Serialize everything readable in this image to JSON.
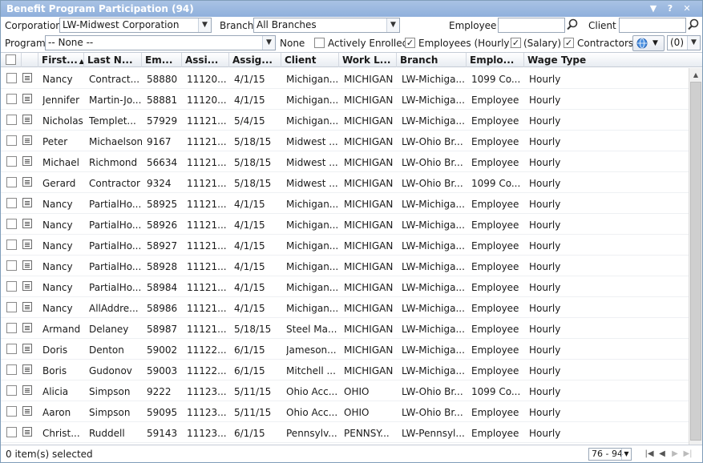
{
  "window": {
    "title": "Benefit Program Participation (94)",
    "controls": {
      "menu": "▼",
      "help": "?",
      "close": "✕"
    }
  },
  "filters": {
    "corporation_label": "Corporation",
    "corporation_value": "LW-Midwest Corporation",
    "branch_label": "Branch",
    "branch_value": "All Branches",
    "employee_label": "Employee",
    "employee_value": "",
    "client_label": "Client",
    "client_value": "",
    "program_label": "Program",
    "program_value": "-- None --",
    "none_label": "None",
    "actively_enrolled": {
      "label": "Actively Enrolled",
      "checked": false
    },
    "employees_hourly": {
      "label": "Employees (Hourly)",
      "checked": true
    },
    "salary": {
      "label": "(Salary)",
      "checked": true
    },
    "contractors": {
      "label": "Contractors",
      "checked": true
    },
    "count_value": "(0)"
  },
  "columns": [
    "First...",
    "Last N...",
    "Em...",
    "Assi...",
    "Assig...",
    "Client",
    "Work L...",
    "Branch",
    "Emplo...",
    "Wage Type"
  ],
  "rows": [
    [
      "Nancy",
      "Contract...",
      "58880",
      "11120...",
      "4/1/15",
      "Michigan...",
      "MICHIGAN",
      "LW-Michiga...",
      "1099 Co...",
      "Hourly"
    ],
    [
      "Jennifer",
      "Martin-Jo...",
      "58881",
      "11120...",
      "4/1/15",
      "Michigan...",
      "MICHIGAN",
      "LW-Michiga...",
      "Employee",
      "Hourly"
    ],
    [
      "Nicholas",
      "Templet...",
      "57929",
      "11121...",
      "5/4/15",
      "Michigan...",
      "MICHIGAN",
      "LW-Michiga...",
      "Employee",
      "Hourly"
    ],
    [
      "Peter",
      "Michaelson",
      "9167",
      "11121...",
      "5/18/15",
      "Midwest ...",
      "MICHIGAN",
      "LW-Ohio Br...",
      "Employee",
      "Hourly"
    ],
    [
      "Michael",
      "Richmond",
      "56634",
      "11121...",
      "5/18/15",
      "Midwest ...",
      "MICHIGAN",
      "LW-Ohio Br...",
      "Employee",
      "Hourly"
    ],
    [
      "Gerard",
      "Contractor",
      "9324",
      "11121...",
      "5/18/15",
      "Midwest ...",
      "MICHIGAN",
      "LW-Ohio Br...",
      "1099 Co...",
      "Hourly"
    ],
    [
      "Nancy",
      "PartialHo...",
      "58925",
      "11121...",
      "4/1/15",
      "Michigan...",
      "MICHIGAN",
      "LW-Michiga...",
      "Employee",
      "Hourly"
    ],
    [
      "Nancy",
      "PartialHo...",
      "58926",
      "11121...",
      "4/1/15",
      "Michigan...",
      "MICHIGAN",
      "LW-Michiga...",
      "Employee",
      "Hourly"
    ],
    [
      "Nancy",
      "PartialHo...",
      "58927",
      "11121...",
      "4/1/15",
      "Michigan...",
      "MICHIGAN",
      "LW-Michiga...",
      "Employee",
      "Hourly"
    ],
    [
      "Nancy",
      "PartialHo...",
      "58928",
      "11121...",
      "4/1/15",
      "Michigan...",
      "MICHIGAN",
      "LW-Michiga...",
      "Employee",
      "Hourly"
    ],
    [
      "Nancy",
      "PartialHo...",
      "58984",
      "11121...",
      "4/1/15",
      "Michigan...",
      "MICHIGAN",
      "LW-Michiga...",
      "Employee",
      "Hourly"
    ],
    [
      "Nancy",
      "AllAddre...",
      "58986",
      "11121...",
      "4/1/15",
      "Michigan...",
      "MICHIGAN",
      "LW-Michiga...",
      "Employee",
      "Hourly"
    ],
    [
      "Armand",
      "Delaney",
      "58987",
      "11121...",
      "5/18/15",
      "Steel Ma...",
      "MICHIGAN",
      "LW-Michiga...",
      "Employee",
      "Hourly"
    ],
    [
      "Doris",
      "Denton",
      "59002",
      "11122...",
      "6/1/15",
      "Jameson...",
      "MICHIGAN",
      "LW-Michiga...",
      "Employee",
      "Hourly"
    ],
    [
      "Boris",
      "Gudonov",
      "59003",
      "11122...",
      "6/1/15",
      "Mitchell ...",
      "MICHIGAN",
      "LW-Michiga...",
      "Employee",
      "Hourly"
    ],
    [
      "Alicia",
      "Simpson",
      "9222",
      "11123...",
      "5/11/15",
      "Ohio Acc...",
      "OHIO",
      "LW-Ohio Br...",
      "1099 Co...",
      "Hourly"
    ],
    [
      "Aaron",
      "Simpson",
      "59095",
      "11123...",
      "5/11/15",
      "Ohio Acc...",
      "OHIO",
      "LW-Ohio Br...",
      "Employee",
      "Hourly"
    ],
    [
      "Christ...",
      "Ruddell",
      "59143",
      "11123...",
      "6/1/15",
      "Pennsylv...",
      "PENNSY...",
      "LW-Pennsyl...",
      "Employee",
      "Hourly"
    ]
  ],
  "status": {
    "selected_text": "0 item(s) selected",
    "page_range": "76 - 94"
  },
  "colors": {
    "title_bar": "#8fb0dc",
    "border": "#7f9db9"
  }
}
